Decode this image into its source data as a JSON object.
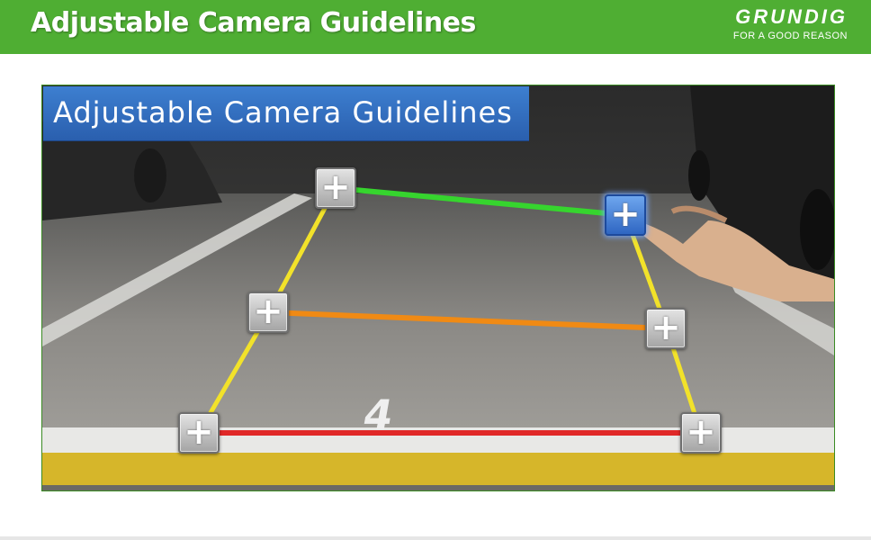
{
  "header": {
    "title": "Adjustable Camera Guidelines",
    "brand_name": "GRUNDIG",
    "brand_tagline": "FOR A GOOD REASON"
  },
  "screen": {
    "banner_title": "Adjustable Camera Guidelines",
    "parking_number": "4",
    "handles": [
      "+",
      "+",
      "+",
      "+",
      "+",
      "+"
    ],
    "active_handle": "top-right"
  },
  "colors": {
    "header_green": "#4fae33",
    "banner_blue": "#2f6cc0",
    "guide_far": "#36d52e",
    "guide_mid": "#f08a14",
    "guide_near": "#e02828",
    "guide_side": "#f2e22a"
  }
}
